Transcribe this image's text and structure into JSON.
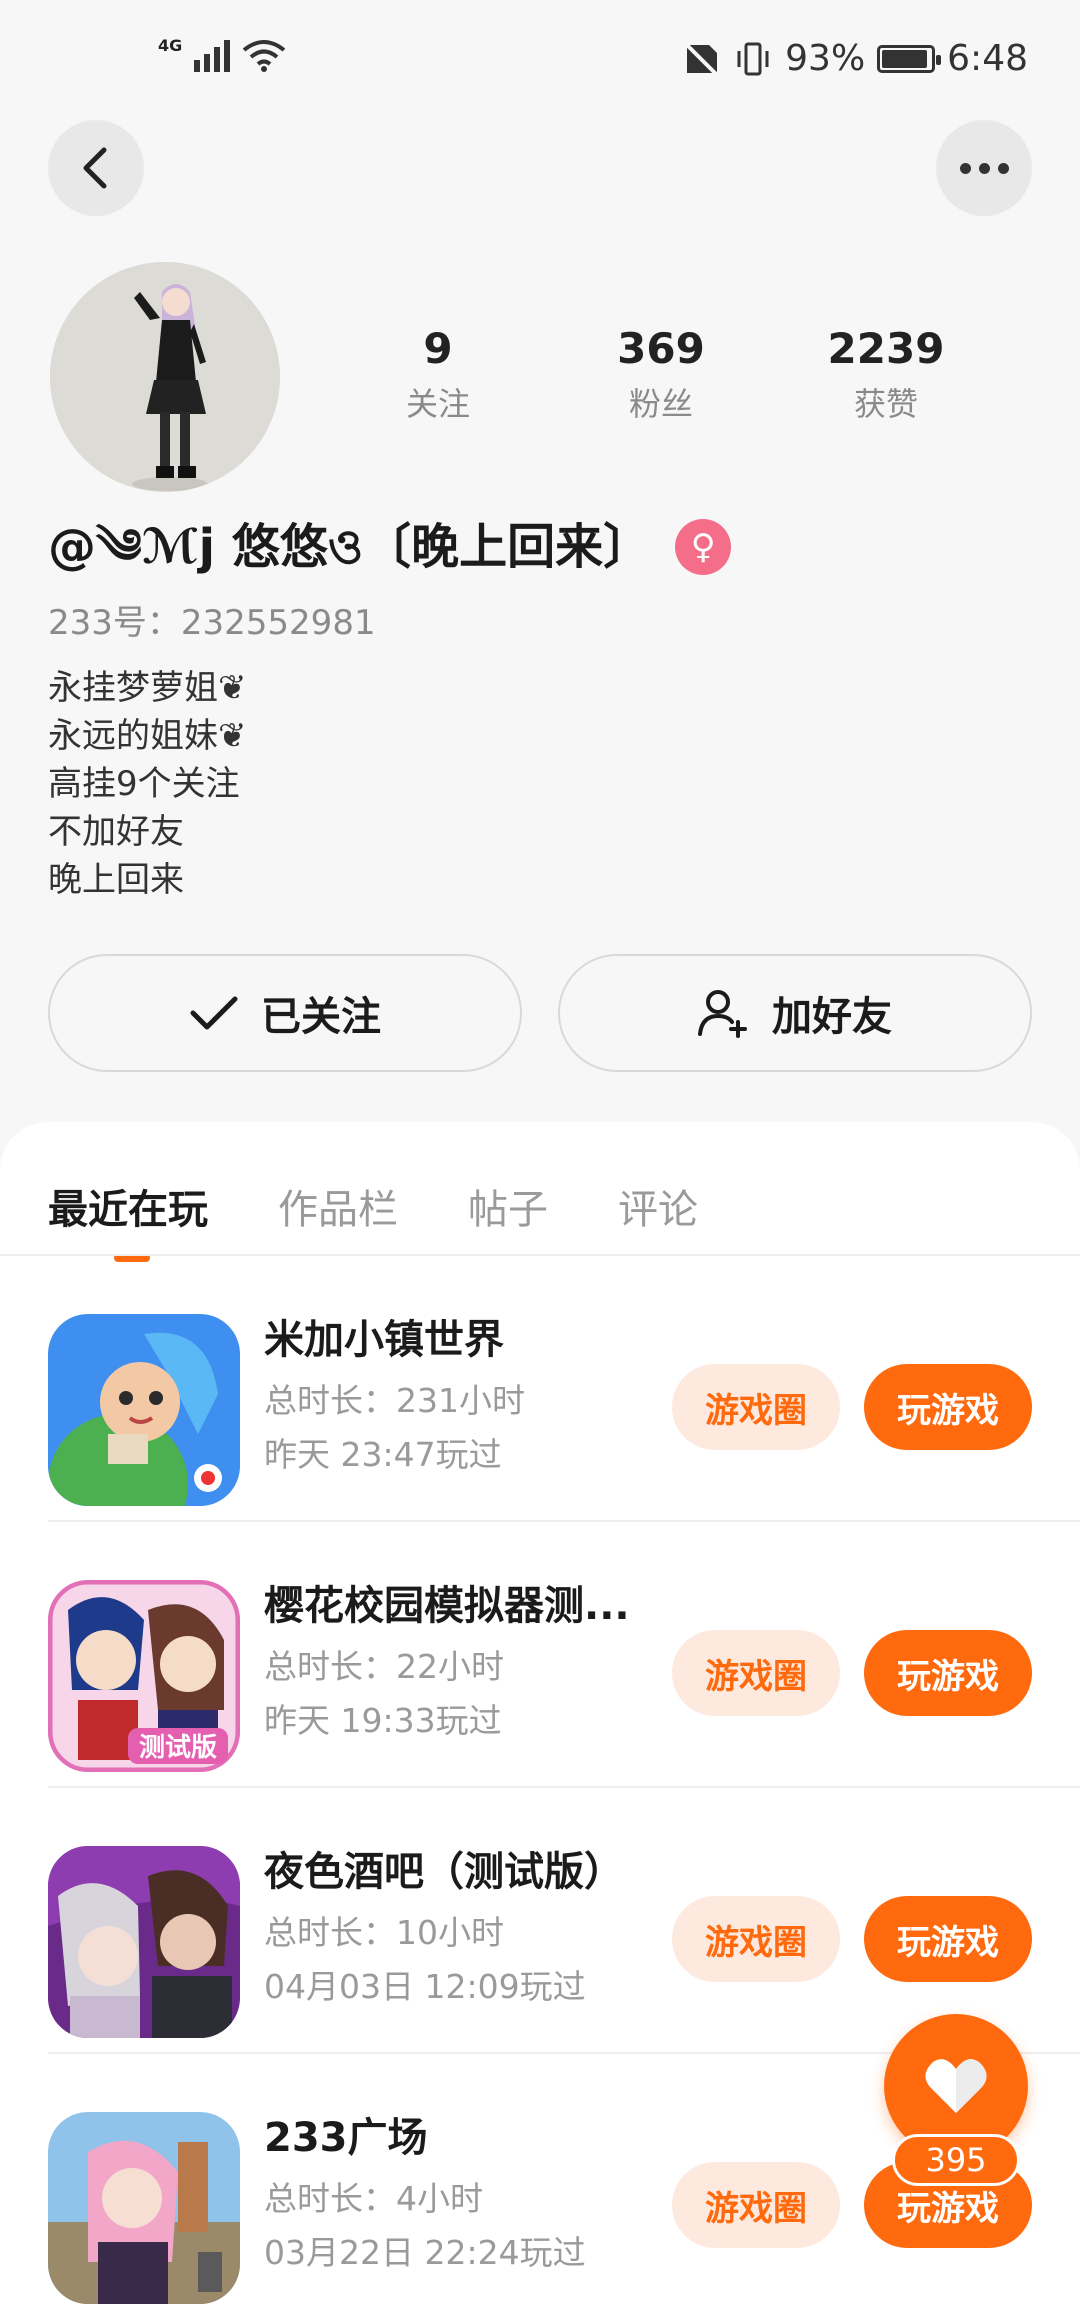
{
  "status_bar": {
    "network": "4G",
    "battery_percent": "93%",
    "battery_level": 0.93,
    "time": "6:48"
  },
  "header": {
    "back_icon": "chevron-left-icon",
    "more_icon": "more-dots-icon"
  },
  "profile": {
    "stats": [
      {
        "value": "9",
        "label": "关注"
      },
      {
        "value": "369",
        "label": "粉丝"
      },
      {
        "value": "2239",
        "label": "获赞"
      }
    ],
    "nickname": "@༄ℳj 悠悠ও〔晚上回来〕",
    "gender_symbol": "♀",
    "uid": "233号：232552981",
    "bio": [
      "永挂梦萝姐❦",
      "永远的姐妹❦",
      "高挂9个关注",
      "不加好友",
      "晚上回来"
    ],
    "followed_label": "已关注",
    "add_friend_label": "加好友"
  },
  "tabs": [
    {
      "label": "最近在玩",
      "active": true
    },
    {
      "label": "作品栏",
      "active": false
    },
    {
      "label": "帖子",
      "active": false
    },
    {
      "label": "评论",
      "active": false
    }
  ],
  "games": [
    {
      "title": "米加小镇世界",
      "duration": "总时长：231小时",
      "last_played": "昨天 23:47玩过",
      "circle_label": "游戏圈",
      "play_label": "玩游戏"
    },
    {
      "title": "樱花校园模拟器测...",
      "duration": "总时长：22小时",
      "last_played": "昨天 19:33玩过",
      "circle_label": "游戏圈",
      "play_label": "玩游戏"
    },
    {
      "title": "夜色酒吧（测试版）",
      "duration": "总时长：10小时",
      "last_played": "04月03日 12:09玩过",
      "circle_label": "游戏圈",
      "play_label": "玩游戏"
    },
    {
      "title": "233广场",
      "duration": "总时长：4小时",
      "last_played": "03月22日 22:24玩过",
      "circle_label": "游戏圈",
      "play_label": "玩游戏"
    }
  ],
  "icon_text": {
    "test_badge": "测试版"
  },
  "like_fab": {
    "icon": "heart-icon",
    "count": "395"
  },
  "colors": {
    "accent": "#ff6a0f",
    "accent_light": "#fde9dd",
    "gender_pink": "#f46e8a"
  }
}
